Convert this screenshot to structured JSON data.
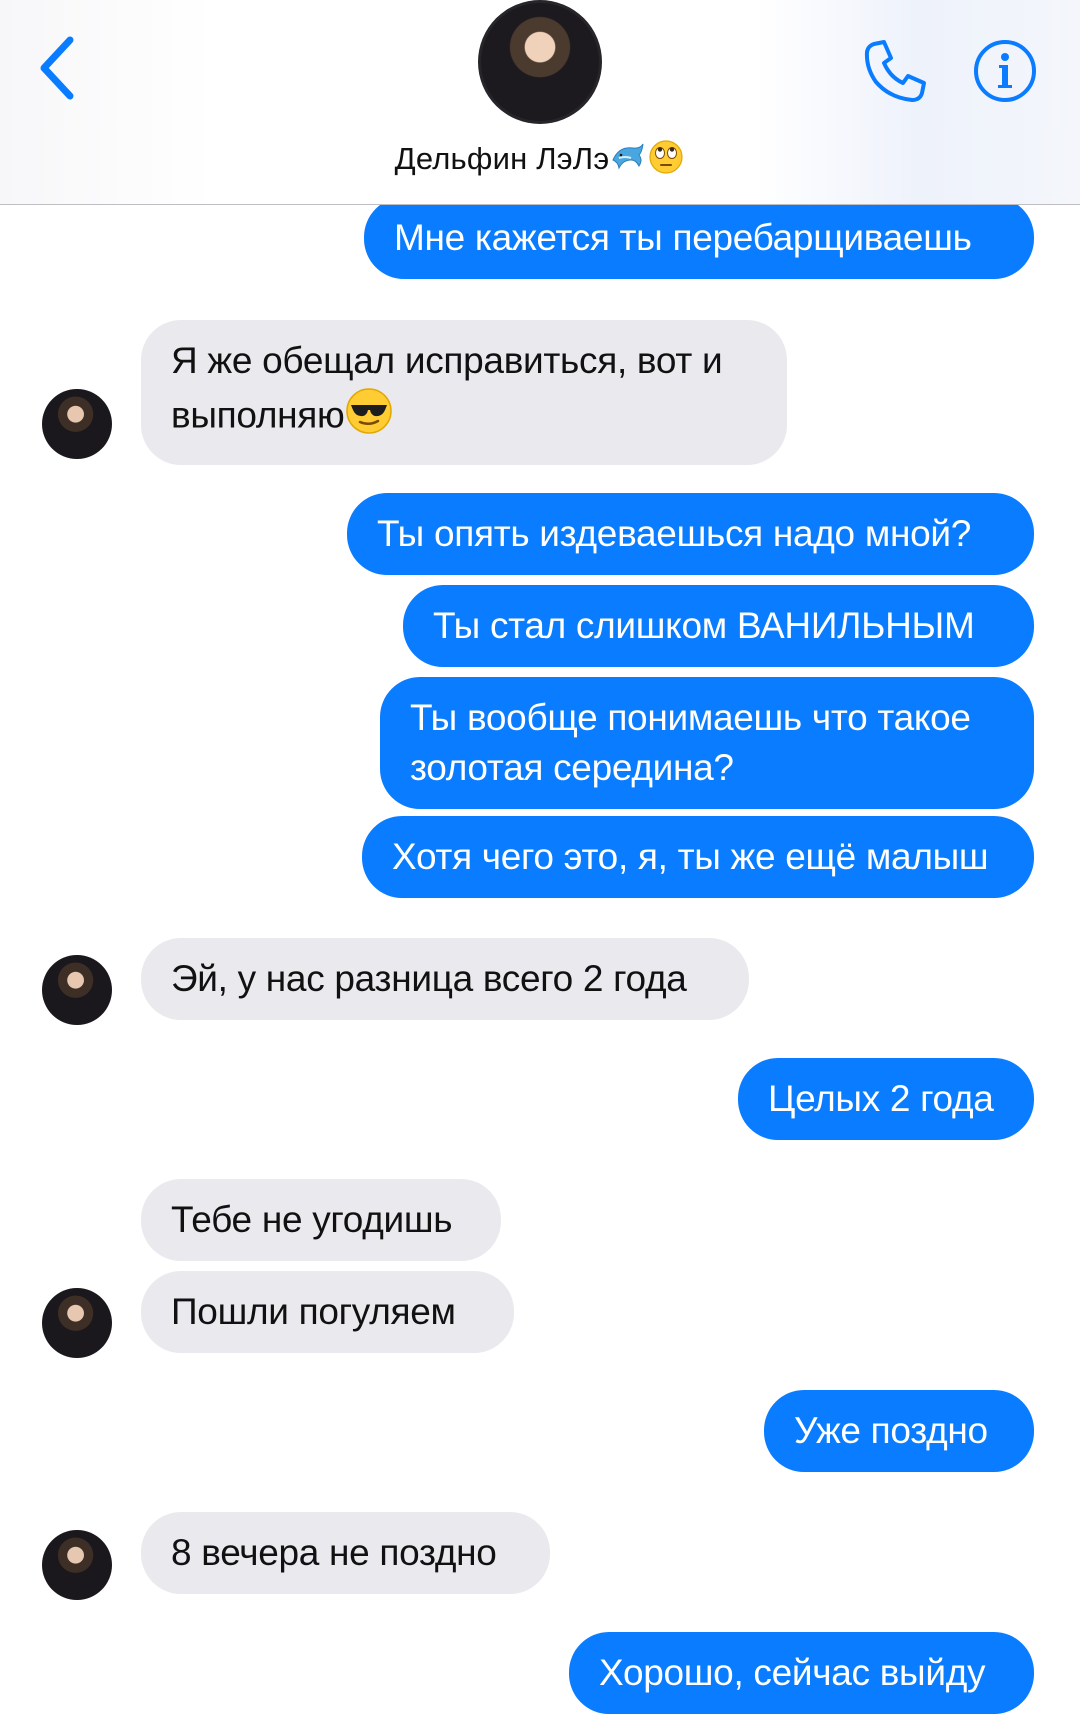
{
  "header": {
    "contact_name": "Дельфин ЛэЛэ",
    "contact_emojis": [
      "dolphin",
      "rolling-eyes"
    ],
    "back_icon": "chevron-left-icon",
    "call_icon": "phone-icon",
    "info_icon": "info-icon"
  },
  "colors": {
    "accent": "#0a7cff",
    "incoming_bubble": "#e9e9ee"
  },
  "messages": [
    {
      "direction": "out",
      "text": "Мне кажется ты перебарщиваешь"
    },
    {
      "direction": "in",
      "text": "Я же обещал исправиться, вот и выполняю",
      "emoji": "sunglasses"
    },
    {
      "direction": "out",
      "text": "Ты опять издеваешься надо мной?"
    },
    {
      "direction": "out",
      "text": "Ты стал слишком ВАНИЛЬНЫМ"
    },
    {
      "direction": "out",
      "text": "Ты вообще понимаешь что такое золотая середина?"
    },
    {
      "direction": "out",
      "text": "Хотя чего это, я, ты же ещё малыш"
    },
    {
      "direction": "in",
      "text": "Эй, у нас разница всего 2 года"
    },
    {
      "direction": "out",
      "text": "Целых 2 года"
    },
    {
      "direction": "in",
      "text": "Тебе не угодишь"
    },
    {
      "direction": "in",
      "text": "Пошли погуляем"
    },
    {
      "direction": "out",
      "text": "Уже поздно"
    },
    {
      "direction": "in",
      "text": "8 вечера не поздно"
    },
    {
      "direction": "out",
      "text": "Хорошо, сейчас выйду"
    }
  ]
}
